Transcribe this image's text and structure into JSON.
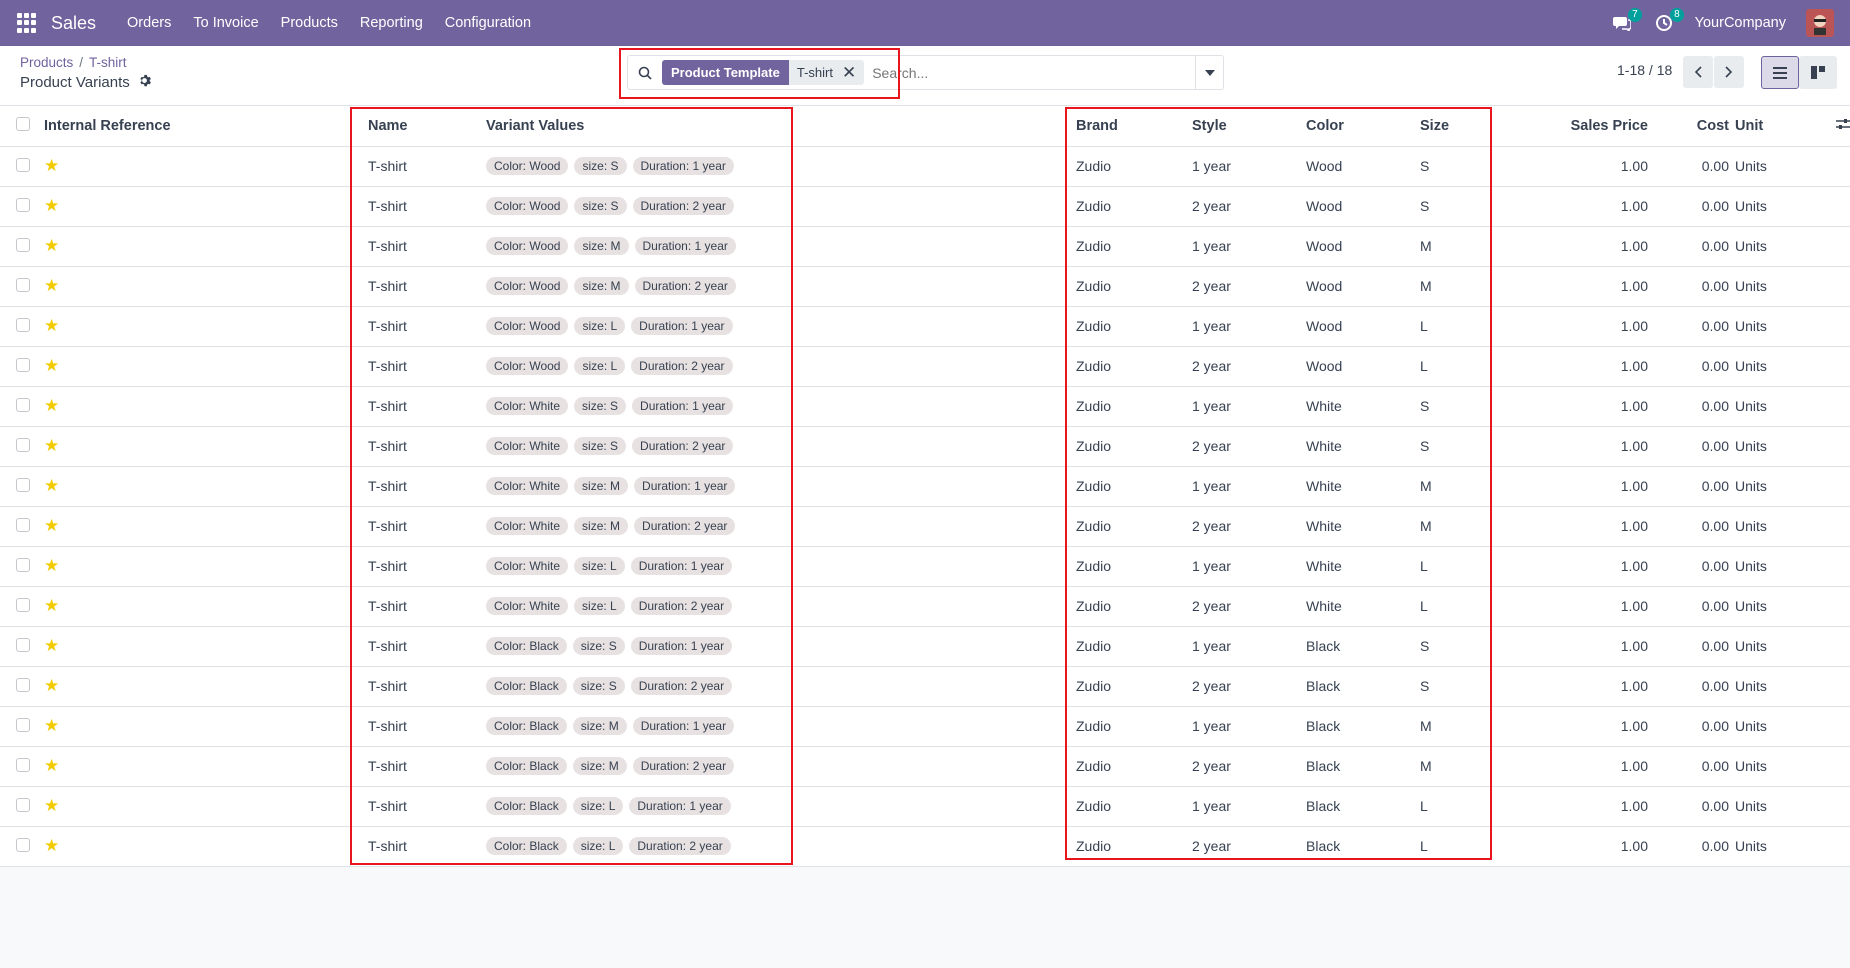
{
  "navbar": {
    "app_name": "Sales",
    "menu": [
      "Orders",
      "To Invoice",
      "Products",
      "Reporting",
      "Configuration"
    ],
    "messages_badge": "7",
    "activities_badge": "8",
    "company": "YourCompany"
  },
  "breadcrumb": {
    "items": [
      "Products",
      "T-shirt"
    ],
    "title": "Product Variants"
  },
  "search": {
    "facet_label": "Product Template",
    "facet_value": "T-shirt",
    "placeholder": "Search..."
  },
  "pager": {
    "value": "1-18 / 18"
  },
  "columns": {
    "internal_reference": "Internal Reference",
    "name": "Name",
    "variant_values": "Variant Values",
    "brand": "Brand",
    "style": "Style",
    "color": "Color",
    "size": "Size",
    "sales_price": "Sales Price",
    "cost": "Cost",
    "unit": "Unit"
  },
  "rows": [
    {
      "name": "T-shirt",
      "tags": [
        "Color: Wood",
        "size: S",
        "Duration: 1 year"
      ],
      "brand": "Zudio",
      "style": "1 year",
      "color": "Wood",
      "size": "S",
      "price": "1.00",
      "cost": "0.00",
      "unit": "Units"
    },
    {
      "name": "T-shirt",
      "tags": [
        "Color: Wood",
        "size: S",
        "Duration: 2 year"
      ],
      "brand": "Zudio",
      "style": "2 year",
      "color": "Wood",
      "size": "S",
      "price": "1.00",
      "cost": "0.00",
      "unit": "Units"
    },
    {
      "name": "T-shirt",
      "tags": [
        "Color: Wood",
        "size: M",
        "Duration: 1 year"
      ],
      "brand": "Zudio",
      "style": "1 year",
      "color": "Wood",
      "size": "M",
      "price": "1.00",
      "cost": "0.00",
      "unit": "Units"
    },
    {
      "name": "T-shirt",
      "tags": [
        "Color: Wood",
        "size: M",
        "Duration: 2 year"
      ],
      "brand": "Zudio",
      "style": "2 year",
      "color": "Wood",
      "size": "M",
      "price": "1.00",
      "cost": "0.00",
      "unit": "Units"
    },
    {
      "name": "T-shirt",
      "tags": [
        "Color: Wood",
        "size: L",
        "Duration: 1 year"
      ],
      "brand": "Zudio",
      "style": "1 year",
      "color": "Wood",
      "size": "L",
      "price": "1.00",
      "cost": "0.00",
      "unit": "Units"
    },
    {
      "name": "T-shirt",
      "tags": [
        "Color: Wood",
        "size: L",
        "Duration: 2 year"
      ],
      "brand": "Zudio",
      "style": "2 year",
      "color": "Wood",
      "size": "L",
      "price": "1.00",
      "cost": "0.00",
      "unit": "Units"
    },
    {
      "name": "T-shirt",
      "tags": [
        "Color: White",
        "size: S",
        "Duration: 1 year"
      ],
      "brand": "Zudio",
      "style": "1 year",
      "color": "White",
      "size": "S",
      "price": "1.00",
      "cost": "0.00",
      "unit": "Units"
    },
    {
      "name": "T-shirt",
      "tags": [
        "Color: White",
        "size: S",
        "Duration: 2 year"
      ],
      "brand": "Zudio",
      "style": "2 year",
      "color": "White",
      "size": "S",
      "price": "1.00",
      "cost": "0.00",
      "unit": "Units"
    },
    {
      "name": "T-shirt",
      "tags": [
        "Color: White",
        "size: M",
        "Duration: 1 year"
      ],
      "brand": "Zudio",
      "style": "1 year",
      "color": "White",
      "size": "M",
      "price": "1.00",
      "cost": "0.00",
      "unit": "Units"
    },
    {
      "name": "T-shirt",
      "tags": [
        "Color: White",
        "size: M",
        "Duration: 2 year"
      ],
      "brand": "Zudio",
      "style": "2 year",
      "color": "White",
      "size": "M",
      "price": "1.00",
      "cost": "0.00",
      "unit": "Units"
    },
    {
      "name": "T-shirt",
      "tags": [
        "Color: White",
        "size: L",
        "Duration: 1 year"
      ],
      "brand": "Zudio",
      "style": "1 year",
      "color": "White",
      "size": "L",
      "price": "1.00",
      "cost": "0.00",
      "unit": "Units"
    },
    {
      "name": "T-shirt",
      "tags": [
        "Color: White",
        "size: L",
        "Duration: 2 year"
      ],
      "brand": "Zudio",
      "style": "2 year",
      "color": "White",
      "size": "L",
      "price": "1.00",
      "cost": "0.00",
      "unit": "Units"
    },
    {
      "name": "T-shirt",
      "tags": [
        "Color: Black",
        "size: S",
        "Duration: 1 year"
      ],
      "brand": "Zudio",
      "style": "1 year",
      "color": "Black",
      "size": "S",
      "price": "1.00",
      "cost": "0.00",
      "unit": "Units"
    },
    {
      "name": "T-shirt",
      "tags": [
        "Color: Black",
        "size: S",
        "Duration: 2 year"
      ],
      "brand": "Zudio",
      "style": "2 year",
      "color": "Black",
      "size": "S",
      "price": "1.00",
      "cost": "0.00",
      "unit": "Units"
    },
    {
      "name": "T-shirt",
      "tags": [
        "Color: Black",
        "size: M",
        "Duration: 1 year"
      ],
      "brand": "Zudio",
      "style": "1 year",
      "color": "Black",
      "size": "M",
      "price": "1.00",
      "cost": "0.00",
      "unit": "Units"
    },
    {
      "name": "T-shirt",
      "tags": [
        "Color: Black",
        "size: M",
        "Duration: 2 year"
      ],
      "brand": "Zudio",
      "style": "2 year",
      "color": "Black",
      "size": "M",
      "price": "1.00",
      "cost": "0.00",
      "unit": "Units"
    },
    {
      "name": "T-shirt",
      "tags": [
        "Color: Black",
        "size: L",
        "Duration: 1 year"
      ],
      "brand": "Zudio",
      "style": "1 year",
      "color": "Black",
      "size": "L",
      "price": "1.00",
      "cost": "0.00",
      "unit": "Units"
    },
    {
      "name": "T-shirt",
      "tags": [
        "Color: Black",
        "size: L",
        "Duration: 2 year"
      ],
      "brand": "Zudio",
      "style": "2 year",
      "color": "Black",
      "size": "L",
      "price": "1.00",
      "cost": "0.00",
      "unit": "Units"
    }
  ],
  "colors": {
    "brand": "#71639e",
    "favorite_star": "#f3cc00",
    "annotation": "#e8141e"
  }
}
